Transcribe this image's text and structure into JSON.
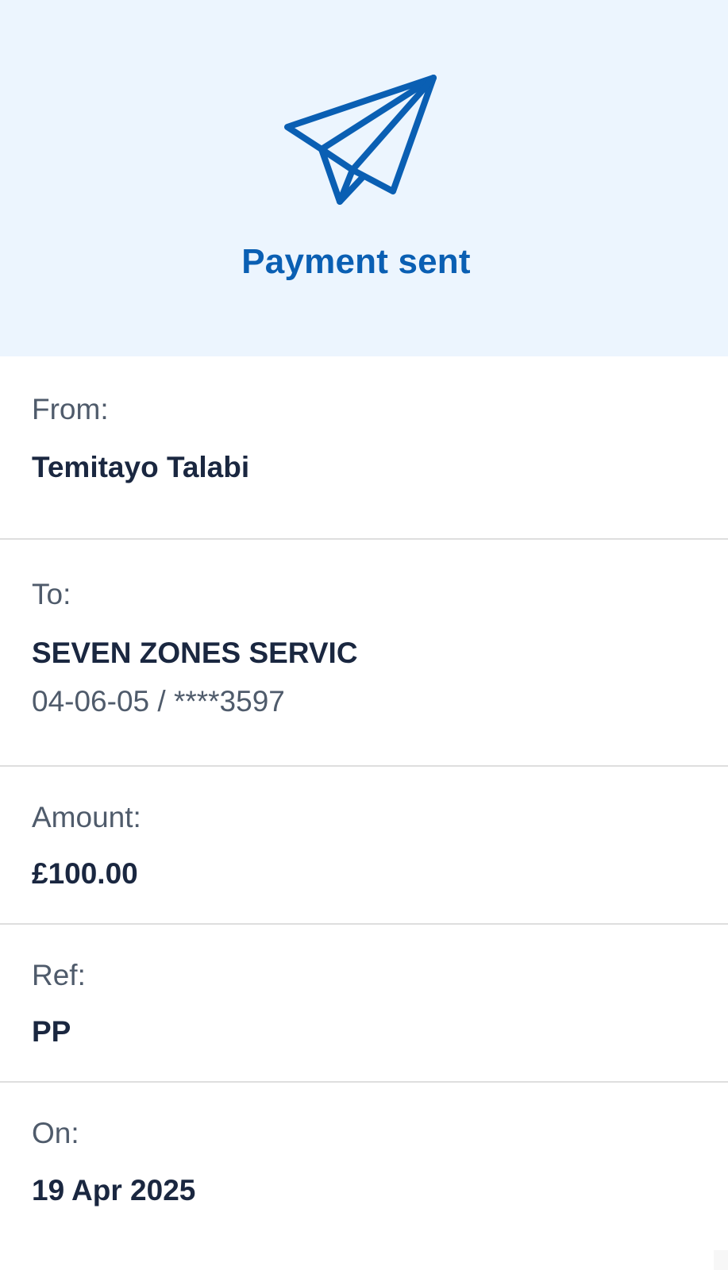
{
  "header": {
    "title": "Payment sent",
    "icon": "paper-plane-icon",
    "accent_color": "#0a5fb3",
    "background_color": "#ecf5fe"
  },
  "details": {
    "from": {
      "label": "From:",
      "value": "Temitayo Talabi"
    },
    "to": {
      "label": "To:",
      "value": "SEVEN ZONES SERVIC",
      "account": "04-06-05 / ****3597"
    },
    "amount": {
      "label": "Amount:",
      "value": "£100.00"
    },
    "ref": {
      "label": "Ref:",
      "value": "PP"
    },
    "on": {
      "label": "On:",
      "value": "19 Apr 2025"
    }
  }
}
